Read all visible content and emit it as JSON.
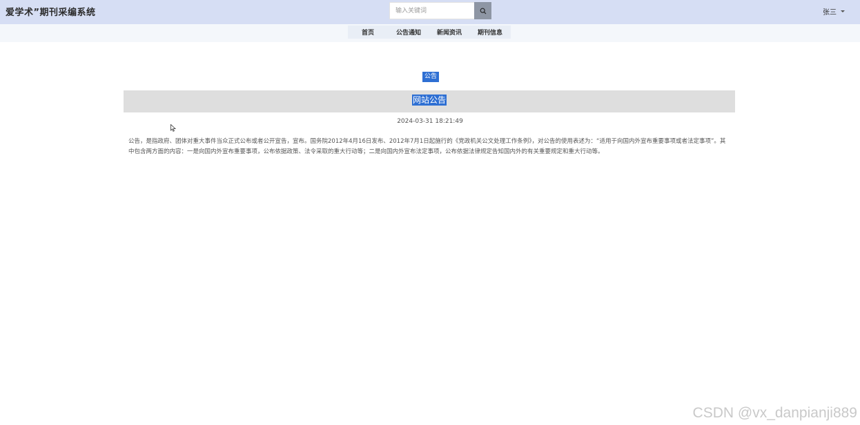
{
  "header": {
    "brand": "爱学术”期刊采编系统",
    "search_placeholder": "输入关键词",
    "search_icon": "search-icon",
    "user_name": "张三",
    "user_menu_icon": "caret-down-icon"
  },
  "nav": {
    "items": [
      "首页",
      "公告通知",
      "新闻资讯",
      "期刊信息"
    ]
  },
  "article": {
    "category": "公告",
    "title": "网站公告",
    "date": "2024-03-31 18:21:49",
    "body": "公告，是指政府、团体对重大事件当众正式公布或者公开宣告，宣布。国务院2012年4月16日发布、2012年7月1日起施行的《党政机关公文处理工作条例》，对公告的使用表述为：“适用于向国内外宣布重要事项或者法定事项”。其中包含两方面的内容：一是向国内外宣布重要事项，公布依据政策、法令采取的重大行动等；二是向国内外宣布法定事项，公布依据法律规定告知国内外的有关重要规定和重大行动等。"
  },
  "watermark": "CSDN @vx_danpianji889",
  "colors": {
    "topbar": "#d6def4",
    "selection": "#2e6fd3",
    "title_band": "#dedede",
    "search_button": "#8e96a4"
  }
}
